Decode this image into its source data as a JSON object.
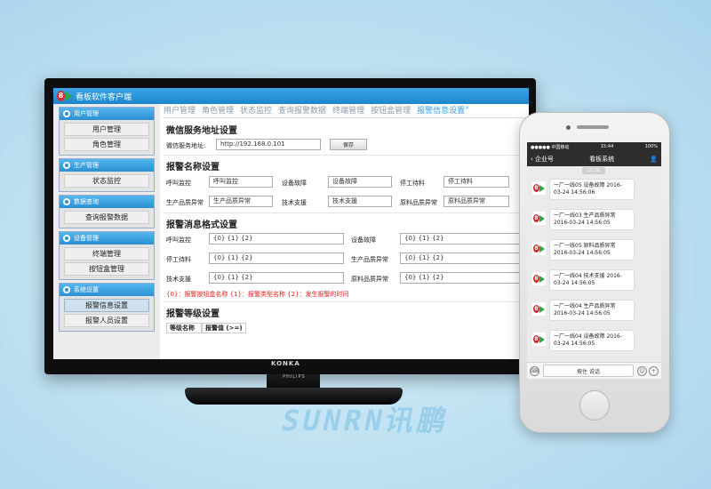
{
  "app": {
    "title": "看板软件客户端"
  },
  "sidebar": {
    "groups": [
      {
        "title": "用户管理",
        "items": [
          "用户管理",
          "角色管理"
        ]
      },
      {
        "title": "生产管理",
        "items": [
          "状态监控"
        ]
      },
      {
        "title": "数据查询",
        "items": [
          "查询报警数据"
        ]
      },
      {
        "title": "设备管理",
        "items": [
          "终端管理",
          "按钮盒管理"
        ]
      },
      {
        "title": "系统设置",
        "items": [
          "报警信息设置",
          "报警人员设置"
        ]
      }
    ]
  },
  "tabs": [
    "用户管理",
    "角色管理",
    "状态监控",
    "查询报警数据",
    "终端管理",
    "按钮盒管理",
    "报警信息设置"
  ],
  "tab_close": "×",
  "wechat": {
    "heading": "微信服务地址设置",
    "label": "微信服务地址:",
    "value": "http://192.168.0.101",
    "save": "保存"
  },
  "alarm_names": {
    "heading": "报警名称设置",
    "rows": [
      [
        {
          "label": "呼叫监控",
          "value": "呼叫监控"
        },
        {
          "label": "设备故障",
          "value": "设备故障"
        },
        {
          "label": "停工待料",
          "value": "停工待料"
        }
      ],
      [
        {
          "label": "生产品质异常",
          "value": "生产品质异常"
        },
        {
          "label": "技术支援",
          "value": "技术支援"
        },
        {
          "label": "原料品质异常",
          "value": "原料品质异常"
        }
      ]
    ]
  },
  "alarm_format": {
    "heading": "报警消息格式设置",
    "rows": [
      [
        {
          "label": "呼叫监控",
          "value": "{0} {1} {2}"
        },
        {
          "label": "设备故障",
          "value": "{0} {1} {2}"
        }
      ],
      [
        {
          "label": "停工待料",
          "value": "{0} {1} {2}"
        },
        {
          "label": "生产品质异常",
          "value": "{0} {1} {2}"
        }
      ],
      [
        {
          "label": "技术支援",
          "value": "{0} {1} {2}"
        },
        {
          "label": "原料品质异常",
          "value": "{0} {1} {2}"
        }
      ]
    ],
    "hint": "{0}：报警按钮盒名称  {1}：报警类型名称  {2}：发生报警的时间"
  },
  "alarm_level": {
    "heading": "报警等级设置",
    "col1": "等级名称",
    "col2": "报警值 (>=)"
  },
  "monitor": {
    "brand": "KONKA",
    "stand_brand": "PHILIPS"
  },
  "watermark": "SUNRN讯鹏",
  "phone": {
    "status_left": "●●●●● 中国移动",
    "status_time": "15:44",
    "status_right": "100%",
    "back": "企业号",
    "title": "看板系统",
    "messages": [
      {
        "time": "15:38",
        "text": "一厂一线05  设备故障  2016-03-24 14:56:06"
      },
      {
        "time": "15:38",
        "text": "一厂一线03  生产品质异常  2016-03-24 14:56:05"
      },
      {
        "time": "15:38",
        "text": "一厂一线05  原料品质异常  2016-03-24 14:56:05"
      },
      {
        "time": "15:38",
        "text": "一厂一线04  技术支援  2016-03-24 14:56:05"
      },
      {
        "time": "15:38",
        "text": "一厂一线04  生产品质异常  2016-03-24 14:56:05"
      },
      {
        "time": "15:38",
        "text": "一厂一线04  设备故障  2016-03-24 14:56:05"
      }
    ],
    "talk": "按住 说话"
  }
}
